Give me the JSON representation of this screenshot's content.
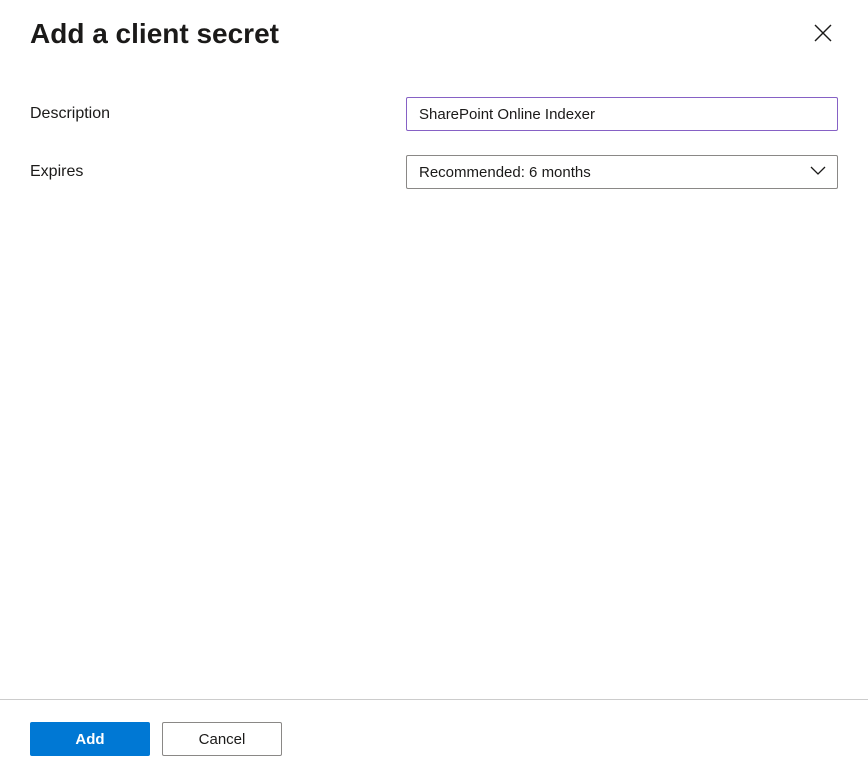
{
  "header": {
    "title": "Add a client secret"
  },
  "form": {
    "description_label": "Description",
    "description_value": "SharePoint Online Indexer",
    "expires_label": "Expires",
    "expires_value": "Recommended: 6 months"
  },
  "footer": {
    "add_label": "Add",
    "cancel_label": "Cancel"
  }
}
